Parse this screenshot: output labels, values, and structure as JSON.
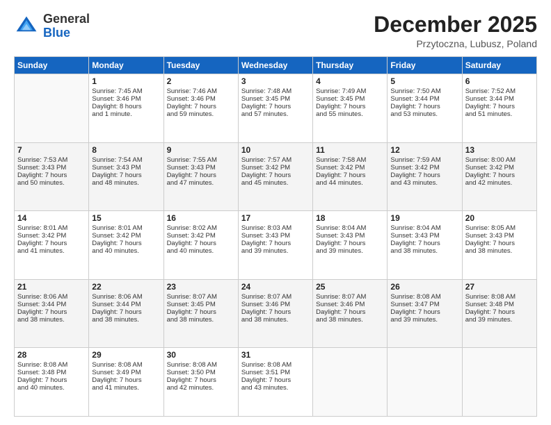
{
  "logo": {
    "general": "General",
    "blue": "Blue"
  },
  "title": "December 2025",
  "location": "Przytoczna, Lubusz, Poland",
  "days_header": [
    "Sunday",
    "Monday",
    "Tuesday",
    "Wednesday",
    "Thursday",
    "Friday",
    "Saturday"
  ],
  "weeks": [
    [
      {
        "day": "",
        "content": ""
      },
      {
        "day": "1",
        "content": "Sunrise: 7:45 AM\nSunset: 3:46 PM\nDaylight: 8 hours\nand 1 minute."
      },
      {
        "day": "2",
        "content": "Sunrise: 7:46 AM\nSunset: 3:46 PM\nDaylight: 7 hours\nand 59 minutes."
      },
      {
        "day": "3",
        "content": "Sunrise: 7:48 AM\nSunset: 3:45 PM\nDaylight: 7 hours\nand 57 minutes."
      },
      {
        "day": "4",
        "content": "Sunrise: 7:49 AM\nSunset: 3:45 PM\nDaylight: 7 hours\nand 55 minutes."
      },
      {
        "day": "5",
        "content": "Sunrise: 7:50 AM\nSunset: 3:44 PM\nDaylight: 7 hours\nand 53 minutes."
      },
      {
        "day": "6",
        "content": "Sunrise: 7:52 AM\nSunset: 3:44 PM\nDaylight: 7 hours\nand 51 minutes."
      }
    ],
    [
      {
        "day": "7",
        "content": "Sunrise: 7:53 AM\nSunset: 3:43 PM\nDaylight: 7 hours\nand 50 minutes."
      },
      {
        "day": "8",
        "content": "Sunrise: 7:54 AM\nSunset: 3:43 PM\nDaylight: 7 hours\nand 48 minutes."
      },
      {
        "day": "9",
        "content": "Sunrise: 7:55 AM\nSunset: 3:43 PM\nDaylight: 7 hours\nand 47 minutes."
      },
      {
        "day": "10",
        "content": "Sunrise: 7:57 AM\nSunset: 3:42 PM\nDaylight: 7 hours\nand 45 minutes."
      },
      {
        "day": "11",
        "content": "Sunrise: 7:58 AM\nSunset: 3:42 PM\nDaylight: 7 hours\nand 44 minutes."
      },
      {
        "day": "12",
        "content": "Sunrise: 7:59 AM\nSunset: 3:42 PM\nDaylight: 7 hours\nand 43 minutes."
      },
      {
        "day": "13",
        "content": "Sunrise: 8:00 AM\nSunset: 3:42 PM\nDaylight: 7 hours\nand 42 minutes."
      }
    ],
    [
      {
        "day": "14",
        "content": "Sunrise: 8:01 AM\nSunset: 3:42 PM\nDaylight: 7 hours\nand 41 minutes."
      },
      {
        "day": "15",
        "content": "Sunrise: 8:01 AM\nSunset: 3:42 PM\nDaylight: 7 hours\nand 40 minutes."
      },
      {
        "day": "16",
        "content": "Sunrise: 8:02 AM\nSunset: 3:42 PM\nDaylight: 7 hours\nand 40 minutes."
      },
      {
        "day": "17",
        "content": "Sunrise: 8:03 AM\nSunset: 3:43 PM\nDaylight: 7 hours\nand 39 minutes."
      },
      {
        "day": "18",
        "content": "Sunrise: 8:04 AM\nSunset: 3:43 PM\nDaylight: 7 hours\nand 39 minutes."
      },
      {
        "day": "19",
        "content": "Sunrise: 8:04 AM\nSunset: 3:43 PM\nDaylight: 7 hours\nand 38 minutes."
      },
      {
        "day": "20",
        "content": "Sunrise: 8:05 AM\nSunset: 3:43 PM\nDaylight: 7 hours\nand 38 minutes."
      }
    ],
    [
      {
        "day": "21",
        "content": "Sunrise: 8:06 AM\nSunset: 3:44 PM\nDaylight: 7 hours\nand 38 minutes."
      },
      {
        "day": "22",
        "content": "Sunrise: 8:06 AM\nSunset: 3:44 PM\nDaylight: 7 hours\nand 38 minutes."
      },
      {
        "day": "23",
        "content": "Sunrise: 8:07 AM\nSunset: 3:45 PM\nDaylight: 7 hours\nand 38 minutes."
      },
      {
        "day": "24",
        "content": "Sunrise: 8:07 AM\nSunset: 3:46 PM\nDaylight: 7 hours\nand 38 minutes."
      },
      {
        "day": "25",
        "content": "Sunrise: 8:07 AM\nSunset: 3:46 PM\nDaylight: 7 hours\nand 38 minutes."
      },
      {
        "day": "26",
        "content": "Sunrise: 8:08 AM\nSunset: 3:47 PM\nDaylight: 7 hours\nand 39 minutes."
      },
      {
        "day": "27",
        "content": "Sunrise: 8:08 AM\nSunset: 3:48 PM\nDaylight: 7 hours\nand 39 minutes."
      }
    ],
    [
      {
        "day": "28",
        "content": "Sunrise: 8:08 AM\nSunset: 3:48 PM\nDaylight: 7 hours\nand 40 minutes."
      },
      {
        "day": "29",
        "content": "Sunrise: 8:08 AM\nSunset: 3:49 PM\nDaylight: 7 hours\nand 41 minutes."
      },
      {
        "day": "30",
        "content": "Sunrise: 8:08 AM\nSunset: 3:50 PM\nDaylight: 7 hours\nand 42 minutes."
      },
      {
        "day": "31",
        "content": "Sunrise: 8:08 AM\nSunset: 3:51 PM\nDaylight: 7 hours\nand 43 minutes."
      },
      {
        "day": "",
        "content": ""
      },
      {
        "day": "",
        "content": ""
      },
      {
        "day": "",
        "content": ""
      }
    ]
  ]
}
